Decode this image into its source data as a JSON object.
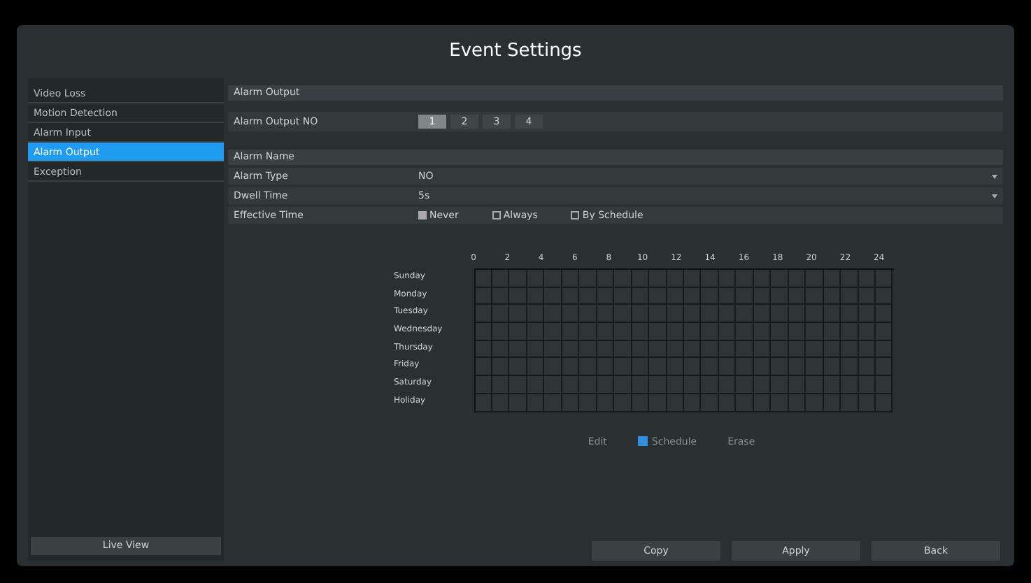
{
  "window": {
    "title": "Event Settings"
  },
  "sidebar": {
    "items": [
      {
        "label": "Video Loss",
        "selected": false
      },
      {
        "label": "Motion Detection",
        "selected": false
      },
      {
        "label": "Alarm Input",
        "selected": false
      },
      {
        "label": "Alarm Output",
        "selected": true
      },
      {
        "label": "Exception",
        "selected": false
      }
    ],
    "live_view_button": "Live View"
  },
  "alarm_output": {
    "header": "Alarm Output",
    "label": "Alarm Output NO",
    "numbers": [
      {
        "label": "1",
        "selected": true
      },
      {
        "label": "2",
        "selected": false
      },
      {
        "label": "3",
        "selected": false
      },
      {
        "label": "4",
        "selected": false
      }
    ]
  },
  "alarm_name": {
    "header": "Alarm Name",
    "fields": [
      {
        "label": "Alarm Type",
        "value": "NO"
      },
      {
        "label": "Dwell Time",
        "value": "5s"
      }
    ],
    "effective_time": {
      "label": "Effective Time",
      "options": [
        {
          "label": "Never",
          "selected": true
        },
        {
          "label": "Always",
          "selected": false
        },
        {
          "label": "By Schedule",
          "selected": false
        }
      ]
    }
  },
  "schedule": {
    "hours": [
      "0",
      "2",
      "4",
      "6",
      "8",
      "10",
      "12",
      "14",
      "16",
      "18",
      "20",
      "22",
      "24"
    ],
    "days": [
      "Sunday",
      "Monday",
      "Tuesday",
      "Wednesday",
      "Thursday",
      "Friday",
      "Saturday",
      "Holiday"
    ],
    "legend": [
      {
        "label": "Edit",
        "selected": false
      },
      {
        "label": "Schedule",
        "selected": true
      },
      {
        "label": "Erase",
        "selected": false
      }
    ]
  },
  "buttons": [
    "Copy",
    "Apply",
    "Back"
  ]
}
